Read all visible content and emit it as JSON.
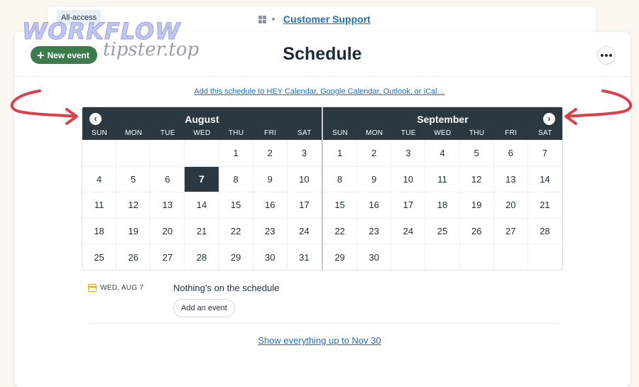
{
  "header": {
    "access_badge": "All-access",
    "project_icon": "grid-icon",
    "project_name": "Customer Support"
  },
  "toolbar": {
    "new_event_label": "New event",
    "page_title": "Schedule",
    "more_icon": "ellipsis-icon"
  },
  "watermark": {
    "line1": "WORKFLOW",
    "line2": "tipster.top"
  },
  "subscribe_link": "Add this schedule to HEY Calendar, Google Calendar, Outlook, or iCal…",
  "calendar": {
    "weekdays": [
      "SUN",
      "MON",
      "TUE",
      "WED",
      "THU",
      "FRI",
      "SAT"
    ],
    "months": [
      {
        "name": "August",
        "leading_blanks": 4,
        "days": [
          1,
          2,
          3,
          4,
          5,
          6,
          7,
          8,
          9,
          10,
          11,
          12,
          13,
          14,
          15,
          16,
          17,
          18,
          19,
          20,
          21,
          22,
          23,
          24,
          25,
          26,
          27,
          28,
          29,
          30,
          31
        ],
        "selected_day": 7
      },
      {
        "name": "September",
        "leading_blanks": 0,
        "days": [
          1,
          2,
          3,
          4,
          5,
          6,
          7,
          8,
          9,
          10,
          11,
          12,
          13,
          14,
          15,
          16,
          17,
          18,
          19,
          20,
          21,
          22,
          23,
          24,
          25,
          26,
          27,
          28,
          29,
          30
        ],
        "selected_day": null
      }
    ],
    "prev_icon": "chevron-left-icon",
    "next_icon": "chevron-right-icon"
  },
  "event_list": {
    "date_label": "WED, AUG 7",
    "empty_message": "Nothing’s on the schedule",
    "add_event_label": "Add an event"
  },
  "show_more_link": "Show everything up to Nov 30",
  "colors": {
    "page_bg": "#fbf6ef",
    "calendar_header": "#2b3840",
    "new_event_bg": "#3b7b4c",
    "link": "#1a6fbd",
    "annotation_arrow": "#d9414b",
    "date_icon": "#e8a21a"
  }
}
